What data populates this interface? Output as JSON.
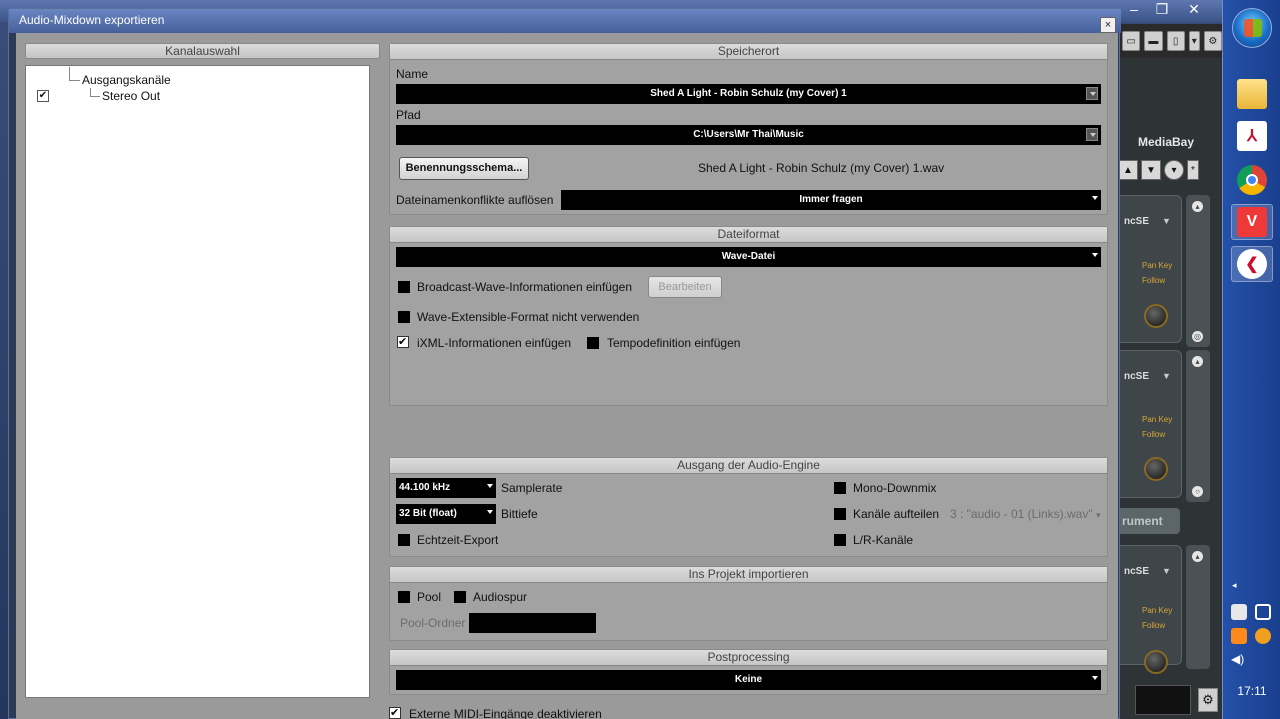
{
  "dialog": {
    "title": "Audio-Mixdown exportieren",
    "close_glyph": "×"
  },
  "channel_select": {
    "header": "Kanalauswahl",
    "group_label": "Ausgangskanäle",
    "items": [
      {
        "label": "Stereo Out",
        "checked": true
      }
    ]
  },
  "storage": {
    "header": "Speicherort",
    "name_label": "Name",
    "name_value": "Shed A Light - Robin Schulz (my Cover) 1",
    "path_label": "Pfad",
    "path_value": "C:\\Users\\Mr Thai\\Music",
    "naming_button": "Benennungsschema...",
    "filename_preview": "Shed A Light - Robin Schulz (my Cover) 1.wav",
    "conflict_label": "Dateinamenkonflikte auflösen",
    "conflict_value": "Immer fragen"
  },
  "file_format": {
    "header": "Dateiformat",
    "format_value": "Wave-Datei",
    "broadcast_label": "Broadcast-Wave-Informationen einfügen",
    "broadcast_checked": false,
    "edit_button": "Bearbeiten",
    "extensible_label": "Wave-Extensible-Format nicht verwenden",
    "extensible_checked": false,
    "ixml_label": "iXML-Informationen einfügen",
    "ixml_checked": true,
    "tempo_label": "Tempodefinition einfügen",
    "tempo_checked": false
  },
  "engine_output": {
    "header": "Ausgang der Audio-Engine",
    "samplerate_value": "44.100 kHz",
    "samplerate_label": "Samplerate",
    "bitdepth_value": "32 Bit (float)",
    "bitdepth_label": "Bittiefe",
    "realtime_label": "Echtzeit-Export",
    "mono_label": "Mono-Downmix",
    "split_label": "Kanäle aufteilen",
    "split_value": "3 : \"audio - 01 (Links).wav\"",
    "lr_label": "L/R-Kanäle"
  },
  "import": {
    "header": "Ins Projekt importieren",
    "pool_label": "Pool",
    "track_label": "Audiospur",
    "folder_label": "Pool-Ordner",
    "folder_value": ""
  },
  "postprocessing": {
    "header": "Postprocessing",
    "value": "Keine"
  },
  "midi": {
    "label": "Externe MIDI-Eingänge deaktivieren",
    "checked": true
  },
  "background": {
    "mediabay_label": "MediaBay",
    "strip_title": "ncSE",
    "pan_key": "Pan Key",
    "follow": "Follow",
    "instrument_button": "rument"
  },
  "taskbar": {
    "clock": "17:11",
    "apps": [
      "folder-icon",
      "pdf-icon",
      "chrome-icon",
      "vivaldi-icon",
      "cubase-icon"
    ]
  },
  "colors": {
    "dialog_body": "#9a9a9a",
    "field_bg": "#000000",
    "taskbar": "#2451a8"
  }
}
